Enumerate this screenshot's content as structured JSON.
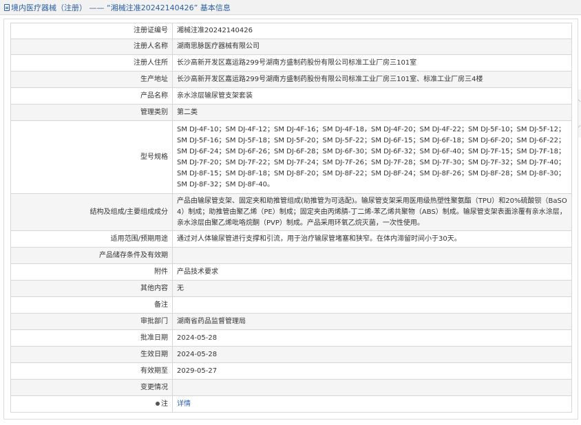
{
  "header": {
    "title": "境内医疗器械（注册） —— “湘械注准20242140426” 基本信息"
  },
  "rows": [
    {
      "label": "注册证编号",
      "value": "湘械注准20242140426"
    },
    {
      "label": "注册人名称",
      "value": "湖南思脉医疗器械有限公司"
    },
    {
      "label": "注册人住所",
      "value": "长沙高新开发区嘉运路299号湖南方盛制药股份有限公司标准工业厂房三101室"
    },
    {
      "label": "生产地址",
      "value": "长沙高新开发区嘉运路299号湖南方盛制药股份有限公司标准工业厂房三101室、标准工业厂房三4楼"
    },
    {
      "label": "产品名称",
      "value": "亲水涂层输尿管支架套装"
    },
    {
      "label": "管理类别",
      "value": "第二类"
    },
    {
      "label": "型号规格",
      "value": "SM DJ-4F-10；SM DJ-4F-12；SM DJ-4F-16；SM DJ-4F-18，SM DJ-4F-20；SM DJ-4F-22；SM DJ-5F-10；SM DJ-5F-12；SM DJ-5F-16；SM DJ-5F-18；SM DJ-5F-20；SM DJ-5F-22；SM DJ-6F-15；SM DJ-6F-18；SM DJ-6F-20；SM DJ-6F-22；SM DJ-6F-24；SM DJ-6F-26；SM DJ-6F-28；SM DJ-6F-30；SM DJ-6F-32；SM DJ-6F-40；SM DJ-7F-15；SM DJ-7F-18；SM DJ-7F-20；SM DJ-7F-22；SM DJ-7F-24；SM DJ-7F-26；SM DJ-7F-28；SM DJ-7F-30；SM DJ-7F-32；SM DJ-7F-40；SM DJ-8F-15；SM DJ-8F-18；SM DJ-8F-20；SM DJ-8F-22；SM DJ-8F-24；SM DJ-8F-26；SM DJ-8F-28；SM DJ-8F-30；SM DJ-8F-32；SM DJ-8F-40。"
    },
    {
      "label": "结构及组成/主要组成成分",
      "value": "产品由输尿管支架、固定夹和助推管组成(助推管为可选配)。输尿管支架采用医用级热塑性聚氨酯（TPU）和20%硫酸钡（BaSO4）制成；助推管由聚乙烯（PE）制成；固定夹由丙烯腈-丁二烯-苯乙烯共聚物（ABS）制成。输尿管支架表面涂覆有亲水涂层，亲水涂层由聚乙烯吡咯烷酮（PVP）制成。产品采用环氧乙烷灭菌，一次性使用。"
    },
    {
      "label": "适用范围/预期用途",
      "value": "通过对人体输尿管进行支撑和引流，用于治疗输尿管堵塞和狭窄。在体内滞留时间小于30天。"
    },
    {
      "label": "产品储存条件及有效期",
      "value": ""
    },
    {
      "label": "附件",
      "value": "产品技术要求"
    },
    {
      "label": "其他内容",
      "value": "无"
    },
    {
      "label": "备注",
      "value": ""
    },
    {
      "label": "审批部门",
      "value": "湖南省药品监督管理局"
    },
    {
      "label": "批准日期",
      "value": "2024-05-28"
    },
    {
      "label": "生效日期",
      "value": "2024-05-28"
    },
    {
      "label": "有效期至",
      "value": "2029-05-27"
    },
    {
      "label": "变更情况",
      "value": ""
    }
  ],
  "note": {
    "label": "注",
    "link": "详情"
  }
}
